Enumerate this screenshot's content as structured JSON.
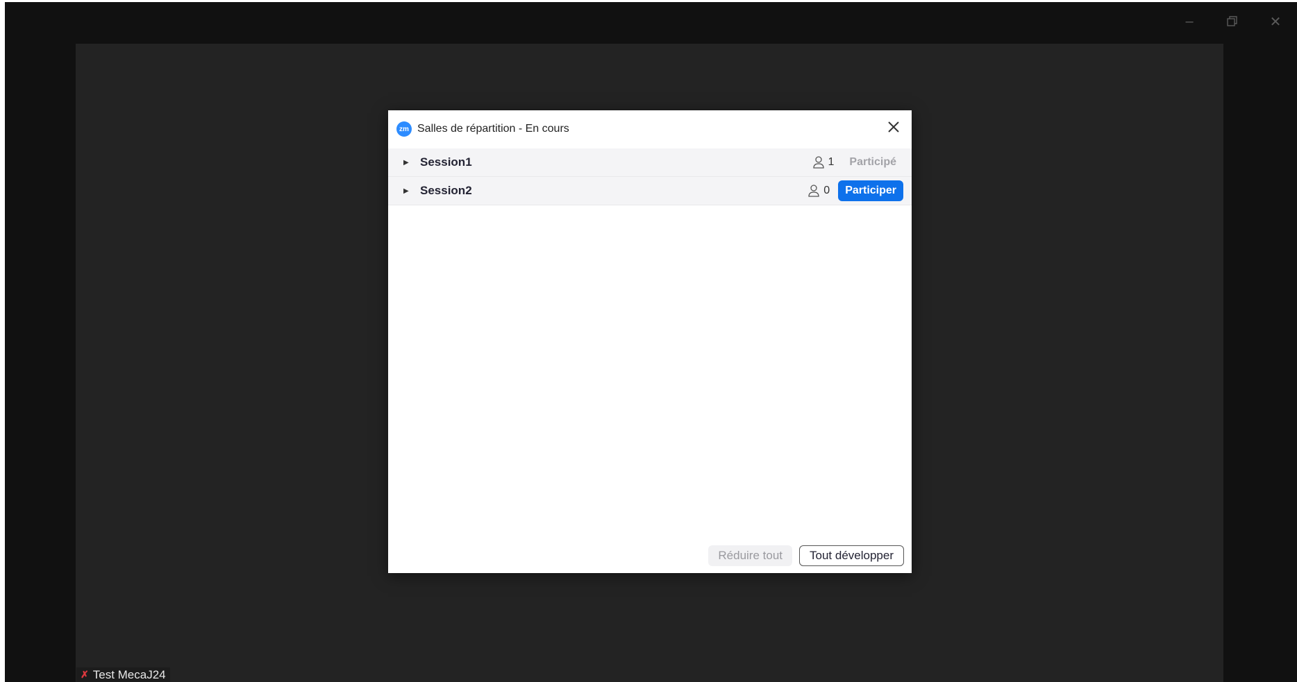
{
  "dialog": {
    "logo": "zm",
    "title": "Salles de répartition - En cours",
    "close_icon": "close-icon",
    "rooms": [
      {
        "name": "Session1",
        "count": "1",
        "action": "Participé",
        "joined": true
      },
      {
        "name": "Session2",
        "count": "0",
        "action": "Participer",
        "joined": false
      }
    ],
    "collapse_all": "Réduire tout",
    "expand_all": "Tout développer"
  },
  "participant": {
    "name": "Test MecaJ24",
    "mic_icon": "mic-muted-icon"
  },
  "colors": {
    "primary": "#0e71eb",
    "brand": "#2d8cff",
    "muted_red": "#e0383e"
  }
}
